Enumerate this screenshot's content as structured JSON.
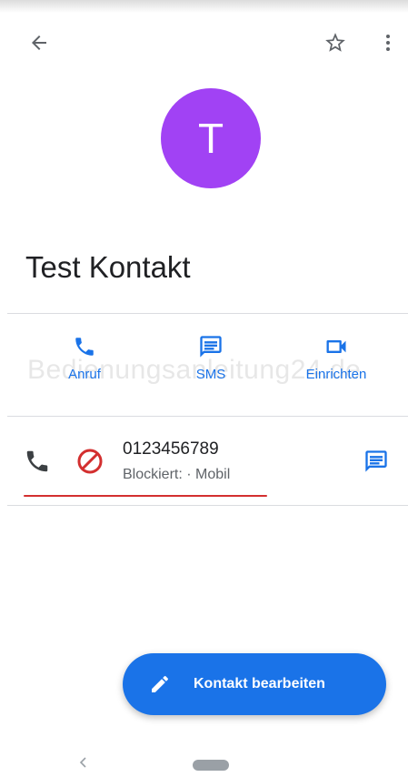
{
  "contact": {
    "initial": "T",
    "name": "Test Kontakt",
    "avatar_color": "#a142f4"
  },
  "icons": {
    "back": "arrow-back-icon",
    "star": "star-outline-icon",
    "more": "more-vert-icon",
    "call": "phone-icon",
    "sms": "message-icon",
    "video": "videocam-icon",
    "blocked": "block-icon",
    "edit": "pencil-icon"
  },
  "actions": [
    {
      "label": "Anruf"
    },
    {
      "label": "SMS"
    },
    {
      "label": "Einrichten"
    }
  ],
  "phone": {
    "number": "0123456789",
    "status": "Blockiert: · Mobil"
  },
  "fab": {
    "label": "Kontakt bearbeiten"
  },
  "watermark": "Bedienungsanleitung24.de",
  "colors": {
    "accent": "#1a73e8",
    "blocked": "#d32f2f",
    "fab": "#1a73e8",
    "icon_dark": "#5f6368"
  }
}
